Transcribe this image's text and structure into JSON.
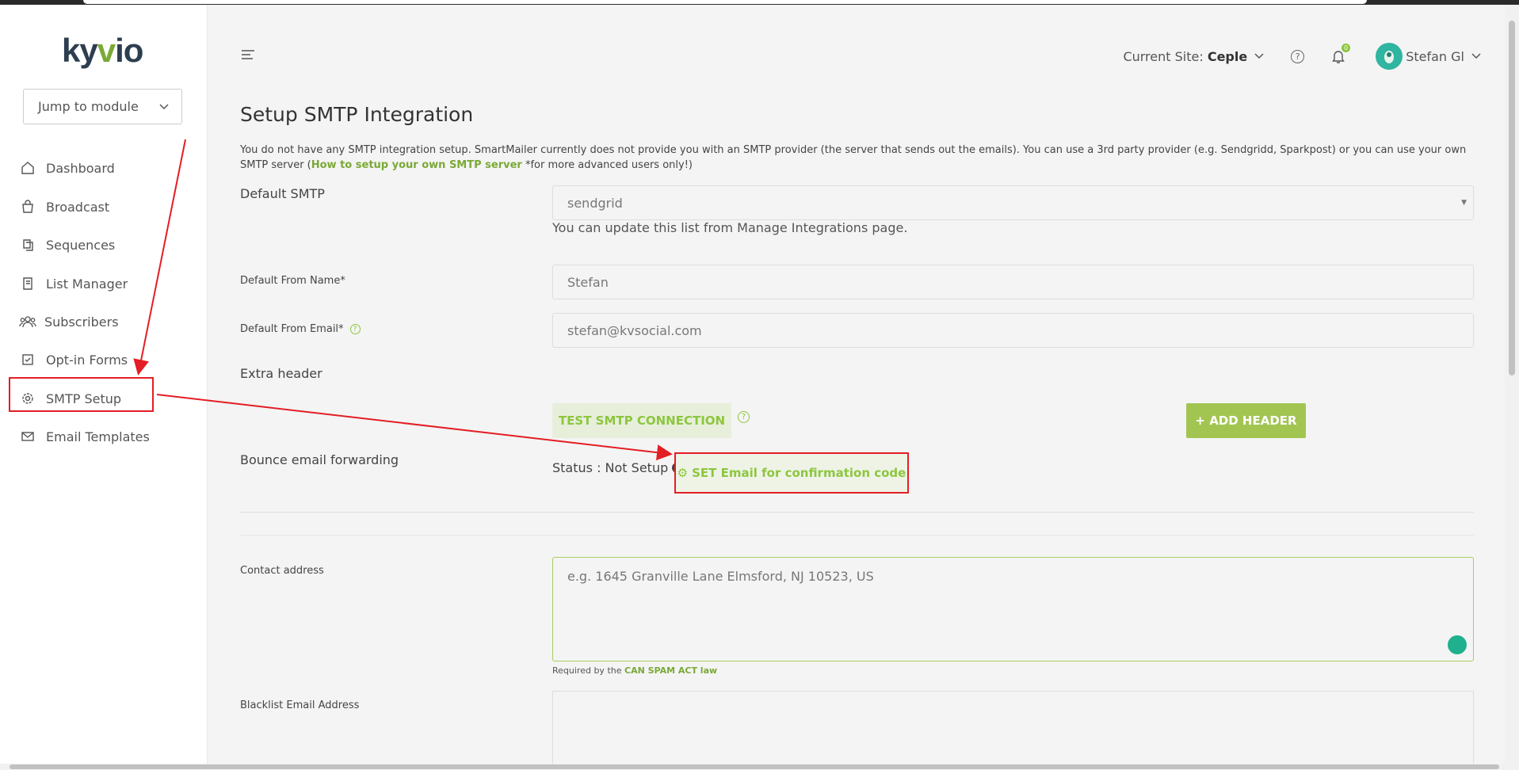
{
  "app": {
    "logo_text": "kyvio",
    "brand_color": "#8dc63f",
    "annotation_color": "#e31e24"
  },
  "sidebar": {
    "jump_placeholder": "Jump to module",
    "items": [
      {
        "label": "Dashboard",
        "icon": "home-icon"
      },
      {
        "label": "Broadcast",
        "icon": "bag-icon"
      },
      {
        "label": "Sequences",
        "icon": "copy-icon"
      },
      {
        "label": "List Manager",
        "icon": "document-icon"
      },
      {
        "label": "Subscribers",
        "icon": "users-icon"
      },
      {
        "label": "Opt-in Forms",
        "icon": "checkbox-icon"
      },
      {
        "label": "SMTP Setup",
        "icon": "gear-icon",
        "active": true
      },
      {
        "label": "Email Templates",
        "icon": "mail-icon"
      }
    ]
  },
  "header": {
    "site_label": "Current Site:",
    "site_name": "Ceple",
    "help_icon": "?",
    "notification_count": "0",
    "user_name": "Stefan Gl"
  },
  "page": {
    "title": "Setup SMTP Integration",
    "intro_text": "You do not have any SMTP integration setup. SmartMailer currently does not provide you with an SMTP provider (the server that sends out the emails). You can use a 3rd party provider (e.g. Sendgridd, Sparkpost) or you can use your own SMTP server (",
    "intro_link": "How to setup your own SMTP server",
    "intro_suffix": " *for more advanced users only!)"
  },
  "form": {
    "default_smtp_label": "Default SMTP",
    "default_smtp_value": "sendgrid",
    "default_smtp_help": "You can update this list from Manage Integrations page.",
    "from_name_label": "Default From Name*",
    "from_name_value": "Stefan",
    "from_email_label": "Default From Email*",
    "from_email_value": "stefan@kvsocial.com",
    "extra_header_label": "Extra header",
    "test_button": "TEST SMTP CONNECTION",
    "add_header_button": "+ ADD HEADER",
    "bounce_label": "Bounce email forwarding",
    "status_text": "Status : Not Setup",
    "set_email_button": "SET Email for confirmation code",
    "contact_label": "Contact address",
    "contact_placeholder": "e.g. 1645 Granville Lane Elmsford, NJ 10523, US",
    "required_note": "Required by the",
    "required_link": "CAN SPAM ACT law",
    "blacklist_label": "Blacklist Email Address"
  }
}
